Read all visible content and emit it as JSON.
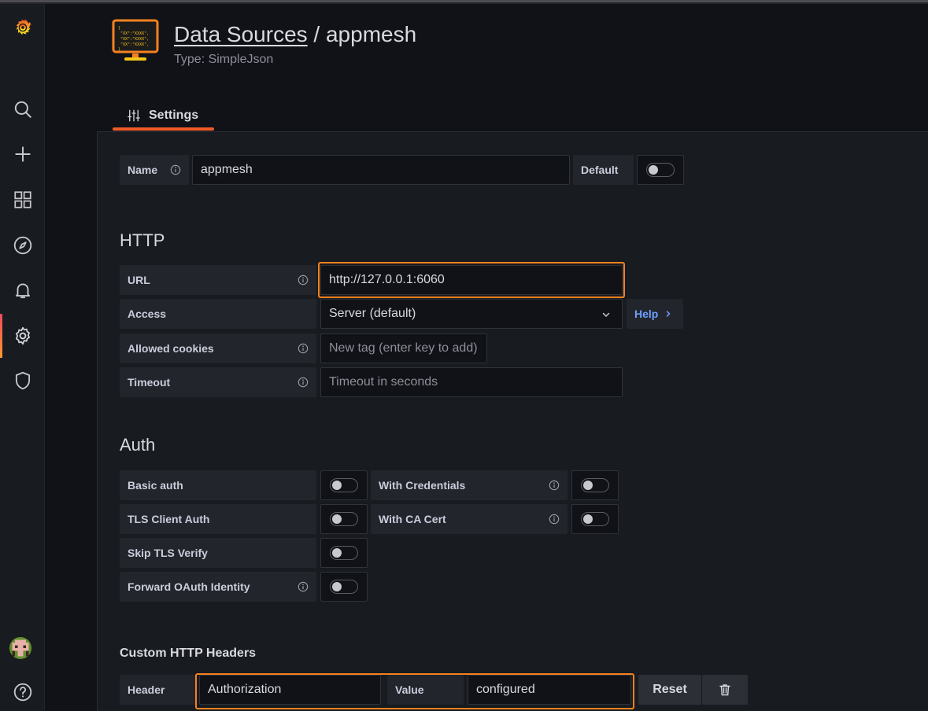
{
  "header": {
    "breadcrumb_link": "Data Sources",
    "separator": " / ",
    "name": "appmesh",
    "type_label": "Type: SimpleJson"
  },
  "tabs": [
    {
      "label": "Settings",
      "icon": "sliders-icon"
    }
  ],
  "sidebar": {
    "items": [
      {
        "name": "grafana-logo",
        "icon": "grafana-logo"
      },
      {
        "name": "search",
        "icon": "search-icon"
      },
      {
        "name": "create",
        "icon": "plus-icon"
      },
      {
        "name": "dashboards",
        "icon": "apps-icon"
      },
      {
        "name": "explore",
        "icon": "compass-icon"
      },
      {
        "name": "alerting",
        "icon": "bell-icon"
      },
      {
        "name": "configuration",
        "icon": "gear-icon",
        "active": true
      },
      {
        "name": "server-admin",
        "icon": "shield-icon"
      },
      {
        "name": "profile",
        "icon": "avatar"
      },
      {
        "name": "help",
        "icon": "question-circle-icon"
      }
    ]
  },
  "general": {
    "name_label": "Name",
    "name_value": "appmesh",
    "default_label": "Default",
    "default_on": false
  },
  "http": {
    "title": "HTTP",
    "url_label": "URL",
    "url_value": "http://127.0.0.1:6060",
    "access_label": "Access",
    "access_value": "Server (default)",
    "help_label": "Help",
    "cookies_label": "Allowed cookies",
    "cookies_placeholder": "New tag (enter key to add)",
    "timeout_label": "Timeout",
    "timeout_placeholder": "Timeout in seconds"
  },
  "auth": {
    "title": "Auth",
    "basic_auth": "Basic auth",
    "with_credentials": "With Credentials",
    "tls_client_auth": "TLS Client Auth",
    "with_ca_cert": "With CA Cert",
    "skip_tls_verify": "Skip TLS Verify",
    "forward_oauth": "Forward OAuth Identity"
  },
  "custom_headers": {
    "title": "Custom HTTP Headers",
    "header_label": "Header",
    "header_value": "Authorization",
    "value_label": "Value",
    "value_value": "configured",
    "reset_label": "Reset"
  },
  "colors": {
    "highlight": "#f58220",
    "accent": "#f05a28",
    "link": "#6e9fff"
  }
}
